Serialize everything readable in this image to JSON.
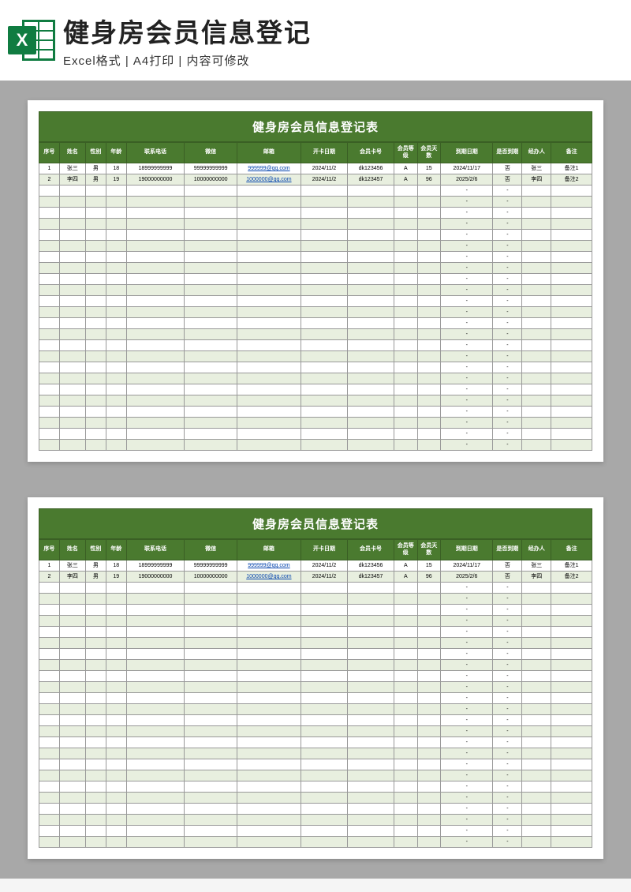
{
  "header": {
    "title": "健身房会员信息登记",
    "subtitle": "Excel格式 | A4打印 | 内容可修改",
    "icon_letter": "X"
  },
  "sheet": {
    "title": "健身房会员信息登记表",
    "columns": [
      "序号",
      "姓名",
      "性别",
      "年龄",
      "联系电话",
      "微信",
      "邮箱",
      "开卡日期",
      "会员卡号",
      "会员等级",
      "会员天数",
      "到期日期",
      "是否到期",
      "经办人",
      "备注"
    ],
    "rows": [
      {
        "seq": "1",
        "name": "张三",
        "gender": "男",
        "age": "18",
        "phone": "18999999999",
        "wechat": "99999999999",
        "email": "999999@qq.com",
        "opendate": "2024/11/2",
        "cardno": "dk123456",
        "level": "A",
        "days": "15",
        "expiry": "2024/11/17",
        "expired": "否",
        "agent": "张三",
        "remark": "备注1"
      },
      {
        "seq": "2",
        "name": "李四",
        "gender": "男",
        "age": "19",
        "phone": "19000000000",
        "wechat": "10000000000",
        "email": "1000000@qq.com",
        "opendate": "2024/11/2",
        "cardno": "dk123457",
        "level": "A",
        "days": "96",
        "expiry": "2025/2/6",
        "expired": "否",
        "agent": "李四",
        "remark": "备注2"
      }
    ],
    "empty_placeholder": "-",
    "empty_row_count": 24
  }
}
